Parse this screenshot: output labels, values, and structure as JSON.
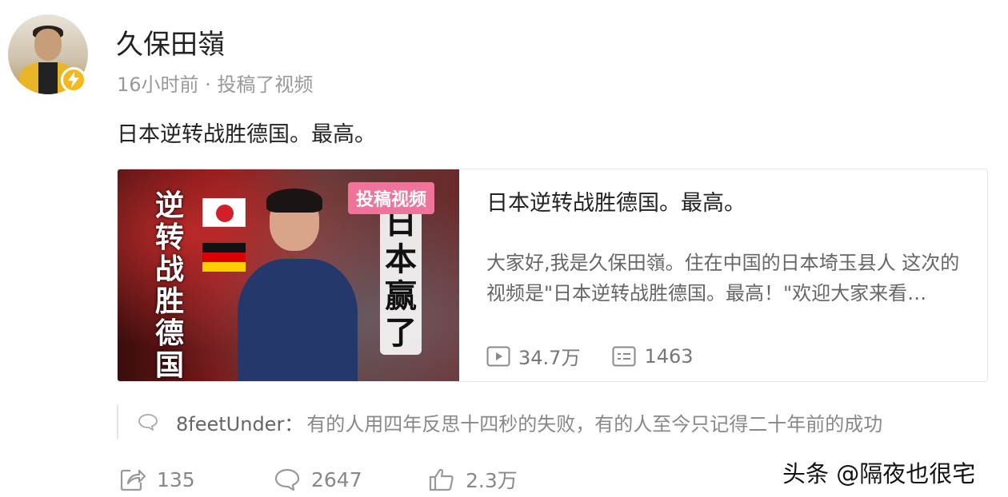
{
  "author": {
    "name": "久保田嶺",
    "meta": "16小时前 · 投稿了视频"
  },
  "post": {
    "text": "日本逆转战胜德国。最高。"
  },
  "video_card": {
    "badge": "投稿视频",
    "thumb_left_text": "逆转战胜德国",
    "thumb_right_text": "日本赢了",
    "title": "日本逆转战胜德国。最高。",
    "description": "大家好,我是久保田嶺。住在中国的日本埼玉县人 这次的视频是\"日本逆转战胜德国。最高！\"欢迎大家来看…",
    "plays": "34.7万",
    "danmaku": "1463"
  },
  "comment": {
    "user": "8feetUnder：",
    "text": "有的人用四年反思十四秒的失败，有的人至今只记得二十年前的成功"
  },
  "actions": {
    "share": "135",
    "comments": "2647",
    "likes": "2.3万"
  },
  "watermark": "头条 @隔夜也很宅",
  "colors": {
    "badge": "#f0739a",
    "verify": "#f3b91f",
    "muted_text": "#999999"
  }
}
